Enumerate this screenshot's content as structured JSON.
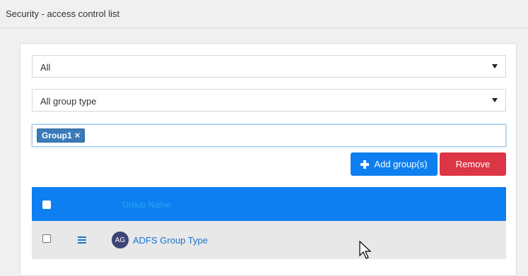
{
  "header": {
    "title": "Security - access control list"
  },
  "filters": {
    "scope": {
      "selected": "All"
    },
    "group_type": {
      "selected": "All group type"
    }
  },
  "tags": [
    {
      "label": "Group1",
      "remove_glyph": "×"
    }
  ],
  "actions": {
    "add_label": "Add group(s)",
    "remove_label": "Remove"
  },
  "table": {
    "columns": [
      "Group Name"
    ],
    "rows": [
      {
        "avatar_initials": "AG",
        "name": "ADFS Group Type"
      }
    ]
  },
  "colors": {
    "primary": "#0d7ff0",
    "danger": "#dc3545",
    "tag": "#3a7bb8"
  }
}
